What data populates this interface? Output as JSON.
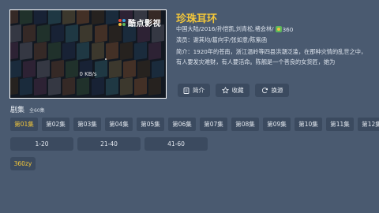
{
  "player": {
    "logo_text": "酷点影视",
    "speed": "0 KB/s"
  },
  "detail": {
    "title": "珍珠耳环",
    "meta_prefix": "中国大陆/2016/孙恺凯,刘青松,褚会林/",
    "meta_rating": "360",
    "actors": "演员：谢其均/葛向宇/张如意/陈紫函",
    "intro": "简介：1920年的苍南，浙江温岭等四县洪潮泛滥，在那种灾情的乱世之中，有人要发灾难财，有人要活命。陈舰是一个善良的女货匠，她为"
  },
  "actions": {
    "intro_label": "简介",
    "fav_label": "收藏",
    "source_label": "换源"
  },
  "episodes": {
    "heading": "剧集",
    "count": "全60集",
    "items": [
      "第01集",
      "第02集",
      "第03集",
      "第04集",
      "第05集",
      "第06集",
      "第07集",
      "第08集",
      "第09集",
      "第10集",
      "第11集",
      "第12集"
    ],
    "ranges": [
      "1-20",
      "21-40",
      "41-60"
    ],
    "source": "360zy"
  },
  "colors": {
    "background": "#4a5a70",
    "button": "#3b4a5f",
    "accent": "#f3c73a"
  }
}
